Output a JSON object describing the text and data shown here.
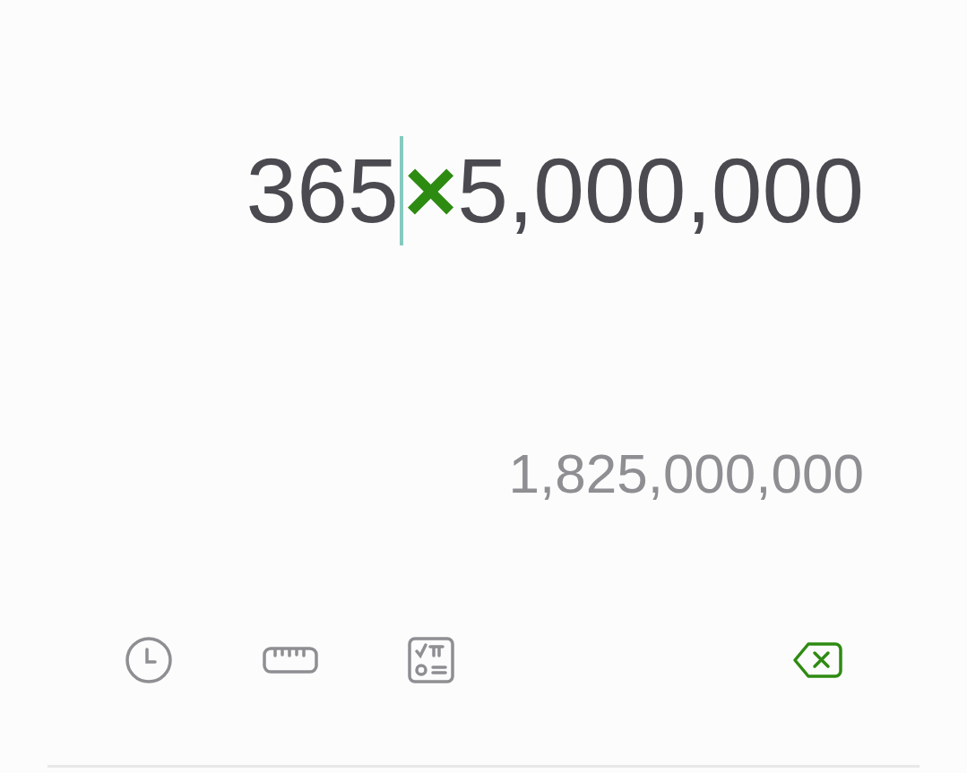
{
  "expression": [
    {
      "kind": "number",
      "text": "365",
      "cursor_after": true
    },
    {
      "kind": "operator",
      "text": "×",
      "cursor_after": false
    },
    {
      "kind": "number",
      "text": "5,000,000",
      "cursor_after": false
    }
  ],
  "result": "1,825,000,000",
  "toolbar": [
    {
      "kind": "history"
    },
    {
      "kind": "unit"
    },
    {
      "kind": "scientific"
    },
    {
      "kind": "backspace"
    }
  ]
}
